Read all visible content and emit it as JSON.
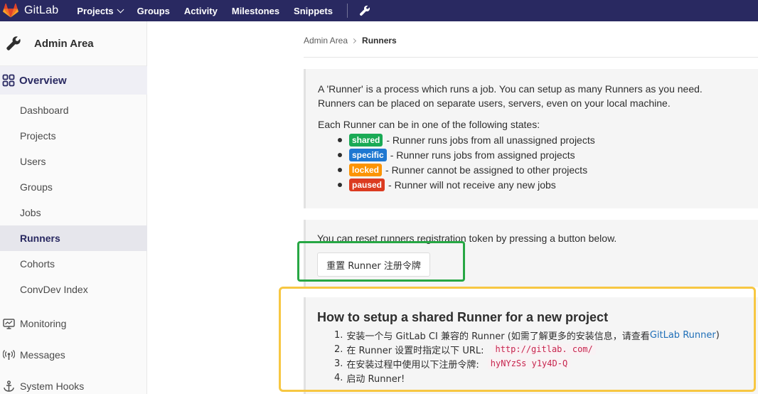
{
  "nav": {
    "brand": "GitLab",
    "links": [
      "Projects",
      "Groups",
      "Activity",
      "Milestones",
      "Snippets"
    ],
    "icons": [
      "gitlab-logo-icon",
      "wrench-icon"
    ]
  },
  "sidebar": {
    "title": "Admin Area",
    "overview_label": "Overview",
    "items": [
      "Dashboard",
      "Projects",
      "Users",
      "Groups",
      "Jobs",
      "Runners",
      "Cohorts",
      "ConvDev Index"
    ],
    "active_item": "Runners",
    "groups": [
      "Monitoring",
      "Messages",
      "System Hooks"
    ]
  },
  "breadcrumb": {
    "parent": "Admin Area",
    "current": "Runners"
  },
  "info": {
    "intro": "A 'Runner' is a process which runs a job. You can setup as many Runners as you need. Runners can be placed on separate users, servers, even on your local machine.",
    "states_intro": "Each Runner can be in one of the following states:",
    "states": [
      {
        "badge": "shared",
        "color": "#1aaa55",
        "text": "- Runner runs jobs from all unassigned projects"
      },
      {
        "badge": "specific",
        "color": "#1f78d1",
        "text": "- Runner runs jobs from assigned projects"
      },
      {
        "badge": "locked",
        "color": "#fc9403",
        "text": "- Runner cannot be assigned to other projects"
      },
      {
        "badge": "paused",
        "color": "#db3b21",
        "text": "- Runner will not receive any new jobs"
      }
    ]
  },
  "reset": {
    "text": "You can reset runners registration token by pressing a button below.",
    "button_label": "重置 Runner 注册令牌"
  },
  "setup": {
    "title": "How to setup a shared Runner for a new project",
    "steps": [
      {
        "num": "1.",
        "text": "安装一个与 GitLab CI 兼容的 Runner (如需了解更多的安装信息，请查看 ",
        "link": "GitLab Runner",
        "suffix": ")"
      },
      {
        "num": "2.",
        "text": "在 Runner 设置时指定以下 URL:",
        "code": "http://gitlab.               com/"
      },
      {
        "num": "3.",
        "text": "在安装过程中使用以下注册令牌:",
        "code": "hyNYzSs         y1y4D-Q"
      },
      {
        "num": "4.",
        "text": "启动 Runner!"
      }
    ]
  },
  "colors": {
    "nav_bg": "#292961",
    "highlight_green": "#27a744",
    "highlight_yellow": "#f7c742"
  }
}
